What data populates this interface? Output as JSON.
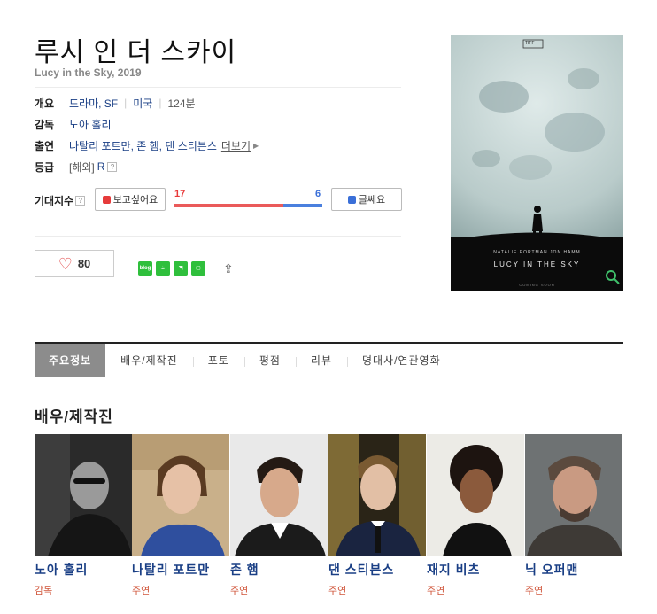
{
  "movie": {
    "title": "루시 인 더 스카이",
    "subtitle": "Lucy in the Sky, 2019"
  },
  "info": {
    "overview_label": "개요",
    "genre": "드라마, SF",
    "country": "미국",
    "runtime": "124분",
    "director_label": "감독",
    "director": "노아 홀리",
    "cast_label": "출연",
    "cast_list": "나탈리 포트만, 존 햄, 댄 스티븐스",
    "more_label": "더보기",
    "rating_label": "등급",
    "rating_prefix": "[해외]",
    "rating": "R",
    "help_glyph": "?"
  },
  "expectation": {
    "label": "기대지수",
    "want_label": "보고싶어요",
    "dont_label": "글쎄요",
    "want_count": "17",
    "dont_count": "6",
    "want_fraction": 0.739
  },
  "like": {
    "count": "80"
  },
  "share": {
    "icons": [
      "blog-icon",
      "cafe-icon",
      "bookmark-icon",
      "line-icon"
    ],
    "blog_text": "blog"
  },
  "poster": {
    "top_badge": "TIFF",
    "credits": "NATALIE PORTMAN   JON HAMM",
    "title_line": "LUCY IN THE SKY",
    "release": "COMING SOON"
  },
  "tabs": [
    {
      "label": "주요정보",
      "active": true
    },
    {
      "label": "배우/제작진",
      "active": false
    },
    {
      "label": "포토",
      "active": false
    },
    {
      "label": "평점",
      "active": false
    },
    {
      "label": "리뷰",
      "active": false
    },
    {
      "label": "명대사/연관영화",
      "active": false
    }
  ],
  "section": {
    "title": "배우/제작진"
  },
  "people": [
    {
      "name": "노아 홀리",
      "role": "감독"
    },
    {
      "name": "나탈리 포트만",
      "role": "주연"
    },
    {
      "name": "존 햄",
      "role": "주연"
    },
    {
      "name": "댄 스티븐스",
      "role": "주연"
    },
    {
      "name": "재지 비츠",
      "role": "주연"
    },
    {
      "name": "닉 오퍼맨",
      "role": "주연"
    }
  ],
  "colors": {
    "link": "#1a3f85",
    "want": "#ea5a5a",
    "dont": "#4a80de",
    "role": "#d0553a",
    "share": "#2fbf3c"
  }
}
